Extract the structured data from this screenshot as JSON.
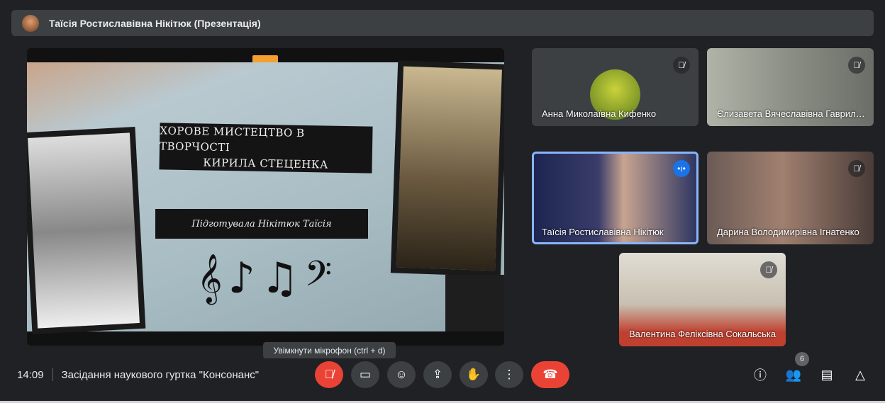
{
  "header": {
    "title": "Таїсія Ростиславівна Нікітюк (Презентація)"
  },
  "presentation": {
    "title_line1": "ХОРОВЕ МИСТЕЦТВО В ТВОРЧОСТІ",
    "title_line2": "КИРИЛА СТЕЦЕНКА",
    "subtitle": "Підготувала Нікітюк Таїсія",
    "notes": "𝄞♪♫𝄢"
  },
  "participants": [
    {
      "name": "Анна Миколаївна Кифенко",
      "muted": true
    },
    {
      "name": "Єлизавета Вячеславівна Гавриленко",
      "muted": true
    },
    {
      "name": "Таїсія Ростиславівна Нікітюк",
      "muted": false,
      "speaking": true
    },
    {
      "name": "Дарина Володимирівна Ігнатенко",
      "muted": true
    },
    {
      "name": "Валентина Феліксівна Сокальська",
      "muted": true
    }
  ],
  "footer": {
    "time": "14:09",
    "meeting_title": "Засідання наукового гуртка \"Консонанс\"",
    "tooltip": "Увімкнути мікрофон (ctrl + d)",
    "participant_count": "6"
  },
  "colors": {
    "background": "#202124",
    "danger": "#ea4335",
    "accent": "#1a73e8"
  }
}
